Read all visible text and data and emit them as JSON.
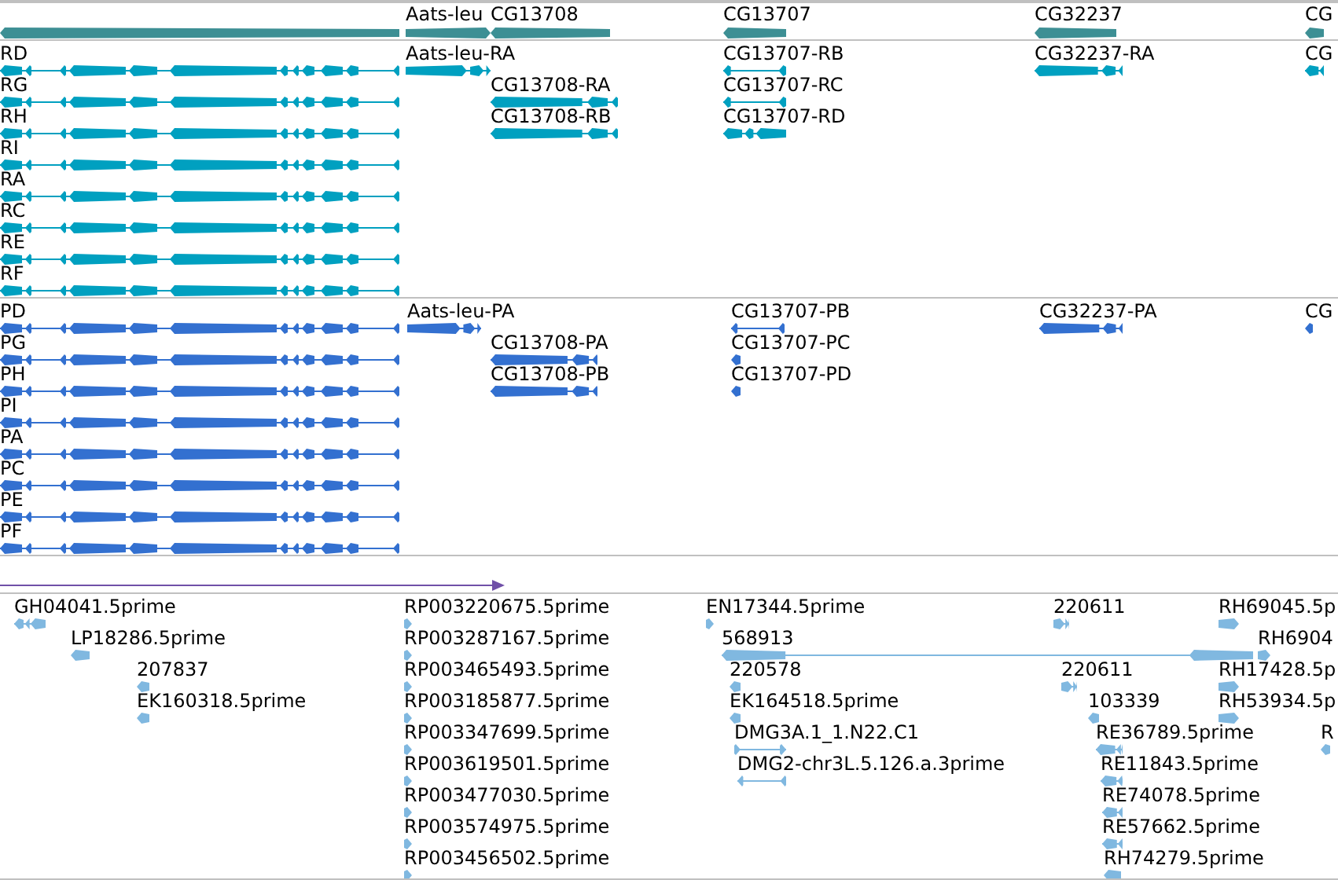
{
  "tracks": [
    {
      "kind": "gene",
      "color": "#3d8f94",
      "features": [
        {
          "kind": "block",
          "reverse": true
        },
        {
          "label": "Aats-leu",
          "kind": "block",
          "reverse": false
        },
        {
          "label": "CG13708",
          "kind": "block",
          "reverse": true
        },
        {
          "label": "CG13707",
          "kind": "block",
          "reverse": true
        },
        {
          "label": "CG32237",
          "kind": "block",
          "reverse": true
        },
        {
          "label": "CG",
          "kind": "block",
          "reverse": true
        }
      ]
    },
    {
      "kind": "transcript",
      "color": "#00a0c0",
      "features": [
        {
          "label": "RD",
          "kind": "multi_exon",
          "reverse": true
        },
        {
          "label": "RG",
          "kind": "multi_exon",
          "reverse": true
        },
        {
          "label": "RH",
          "kind": "multi_exon",
          "reverse": true
        },
        {
          "label": "RI",
          "kind": "multi_exon",
          "reverse": true
        },
        {
          "label": "RA",
          "kind": "multi_exon",
          "reverse": true
        },
        {
          "label": "RC",
          "kind": "multi_exon",
          "reverse": true
        },
        {
          "label": "RE",
          "kind": "multi_exon",
          "reverse": true
        },
        {
          "label": "RF",
          "kind": "multi_exon",
          "reverse": true
        },
        {
          "label": "Aats-leu-RA",
          "kind": "split",
          "reverse": false
        },
        {
          "label": "CG13708-RA",
          "kind": "split",
          "reverse": true
        },
        {
          "label": "CG13708-RB",
          "kind": "split",
          "reverse": true
        },
        {
          "label": "CG13707-RB",
          "kind": "intron",
          "reverse": true
        },
        {
          "label": "CG13707-RC",
          "kind": "intron",
          "reverse": true
        },
        {
          "label": "CG13707-RD",
          "kind": "triple",
          "reverse": true
        },
        {
          "label": "CG32237-RA",
          "kind": "split",
          "reverse": true
        },
        {
          "label": "CG",
          "kind": "split",
          "reverse": true
        }
      ]
    },
    {
      "kind": "protein",
      "color": "#3370d0",
      "features": [
        {
          "label": "PD",
          "kind": "multi_exon",
          "reverse": true
        },
        {
          "label": "PG",
          "kind": "multi_exon",
          "reverse": true
        },
        {
          "label": "PH",
          "kind": "multi_exon",
          "reverse": true
        },
        {
          "label": "PI",
          "kind": "multi_exon",
          "reverse": true
        },
        {
          "label": "PA",
          "kind": "multi_exon",
          "reverse": true
        },
        {
          "label": "PC",
          "kind": "multi_exon",
          "reverse": true
        },
        {
          "label": "PE",
          "kind": "multi_exon",
          "reverse": true
        },
        {
          "label": "PF",
          "kind": "multi_exon",
          "reverse": true
        },
        {
          "label": "Aats-leu-PA",
          "kind": "split",
          "reverse": false
        },
        {
          "label": "CG13708-PA",
          "kind": "split",
          "reverse": true
        },
        {
          "label": "CG13708-PB",
          "kind": "split",
          "reverse": true
        },
        {
          "label": "CG13707-PB",
          "kind": "intron",
          "reverse": true
        },
        {
          "label": "CG13707-PC",
          "kind": "tick",
          "reverse": true
        },
        {
          "label": "CG13707-PD",
          "kind": "tick",
          "reverse": true
        },
        {
          "label": "CG32237-PA",
          "kind": "split",
          "reverse": true
        },
        {
          "label": "CG",
          "kind": "tick",
          "reverse": true
        }
      ]
    },
    {
      "kind": "arrow",
      "color": "#7050a8"
    },
    {
      "kind": "est",
      "color": "#80b8e0",
      "features": [
        {
          "label": "GH04041.5prime",
          "kind": "triple",
          "reverse": true
        },
        {
          "label": "LP18286.5prime",
          "kind": "block",
          "reverse": true
        },
        {
          "label": "207837",
          "kind": "tick",
          "reverse": true
        },
        {
          "label": "EK160318.5prime",
          "kind": "tick",
          "reverse": true
        },
        {
          "label": "RP003220675.5prime",
          "kind": "tick",
          "reverse": false
        },
        {
          "label": "RP003287167.5prime",
          "kind": "tick",
          "reverse": false
        },
        {
          "label": "RP003465493.5prime",
          "kind": "tick",
          "reverse": false
        },
        {
          "label": "RP003185877.5prime",
          "kind": "tick",
          "reverse": false
        },
        {
          "label": "RP003347699.5prime",
          "kind": "tick",
          "reverse": false
        },
        {
          "label": "RP003619501.5prime",
          "kind": "tick",
          "reverse": false
        },
        {
          "label": "RP003477030.5prime",
          "kind": "tick",
          "reverse": false
        },
        {
          "label": "RP003574975.5prime",
          "kind": "tick",
          "reverse": false
        },
        {
          "label": "RP003456502.5prime",
          "kind": "tick",
          "reverse": false
        },
        {
          "label": "EN17344.5prime",
          "kind": "tick",
          "reverse": false
        },
        {
          "label": "568913",
          "kind": "intron",
          "reverse": true
        },
        {
          "label": "220578",
          "kind": "tick",
          "reverse": true
        },
        {
          "label": "EK164518.5prime",
          "kind": "tick",
          "reverse": true
        },
        {
          "label": "DMG3A.1_1.N22.C1",
          "kind": "intron",
          "reverse": false
        },
        {
          "label": "DMG2-chr3L.5.126.a.3prime",
          "kind": "intron",
          "reverse": true
        },
        {
          "label": "220611",
          "kind": "split",
          "reverse": false
        },
        {
          "label": "220611",
          "kind": "split",
          "reverse": false
        },
        {
          "label": "103339",
          "kind": "tick",
          "reverse": true
        },
        {
          "label": "RE36789.5prime",
          "kind": "split",
          "reverse": true
        },
        {
          "label": "RE11843.5prime",
          "kind": "split",
          "reverse": true
        },
        {
          "label": "RE74078.5prime",
          "kind": "split",
          "reverse": true
        },
        {
          "label": "RE57662.5prime",
          "kind": "split",
          "reverse": true
        },
        {
          "label": "RH74279.5prime",
          "kind": "block",
          "reverse": true
        },
        {
          "label": "RH69045.5p",
          "kind": "block",
          "reverse": false
        },
        {
          "label": "RH6904",
          "kind": "block",
          "reverse": false
        },
        {
          "label": "RH17428.5p",
          "kind": "block",
          "reverse": false
        },
        {
          "label": "RH53934.5p",
          "kind": "block",
          "reverse": false
        },
        {
          "label": "R",
          "kind": "tick",
          "reverse": true
        }
      ]
    }
  ]
}
